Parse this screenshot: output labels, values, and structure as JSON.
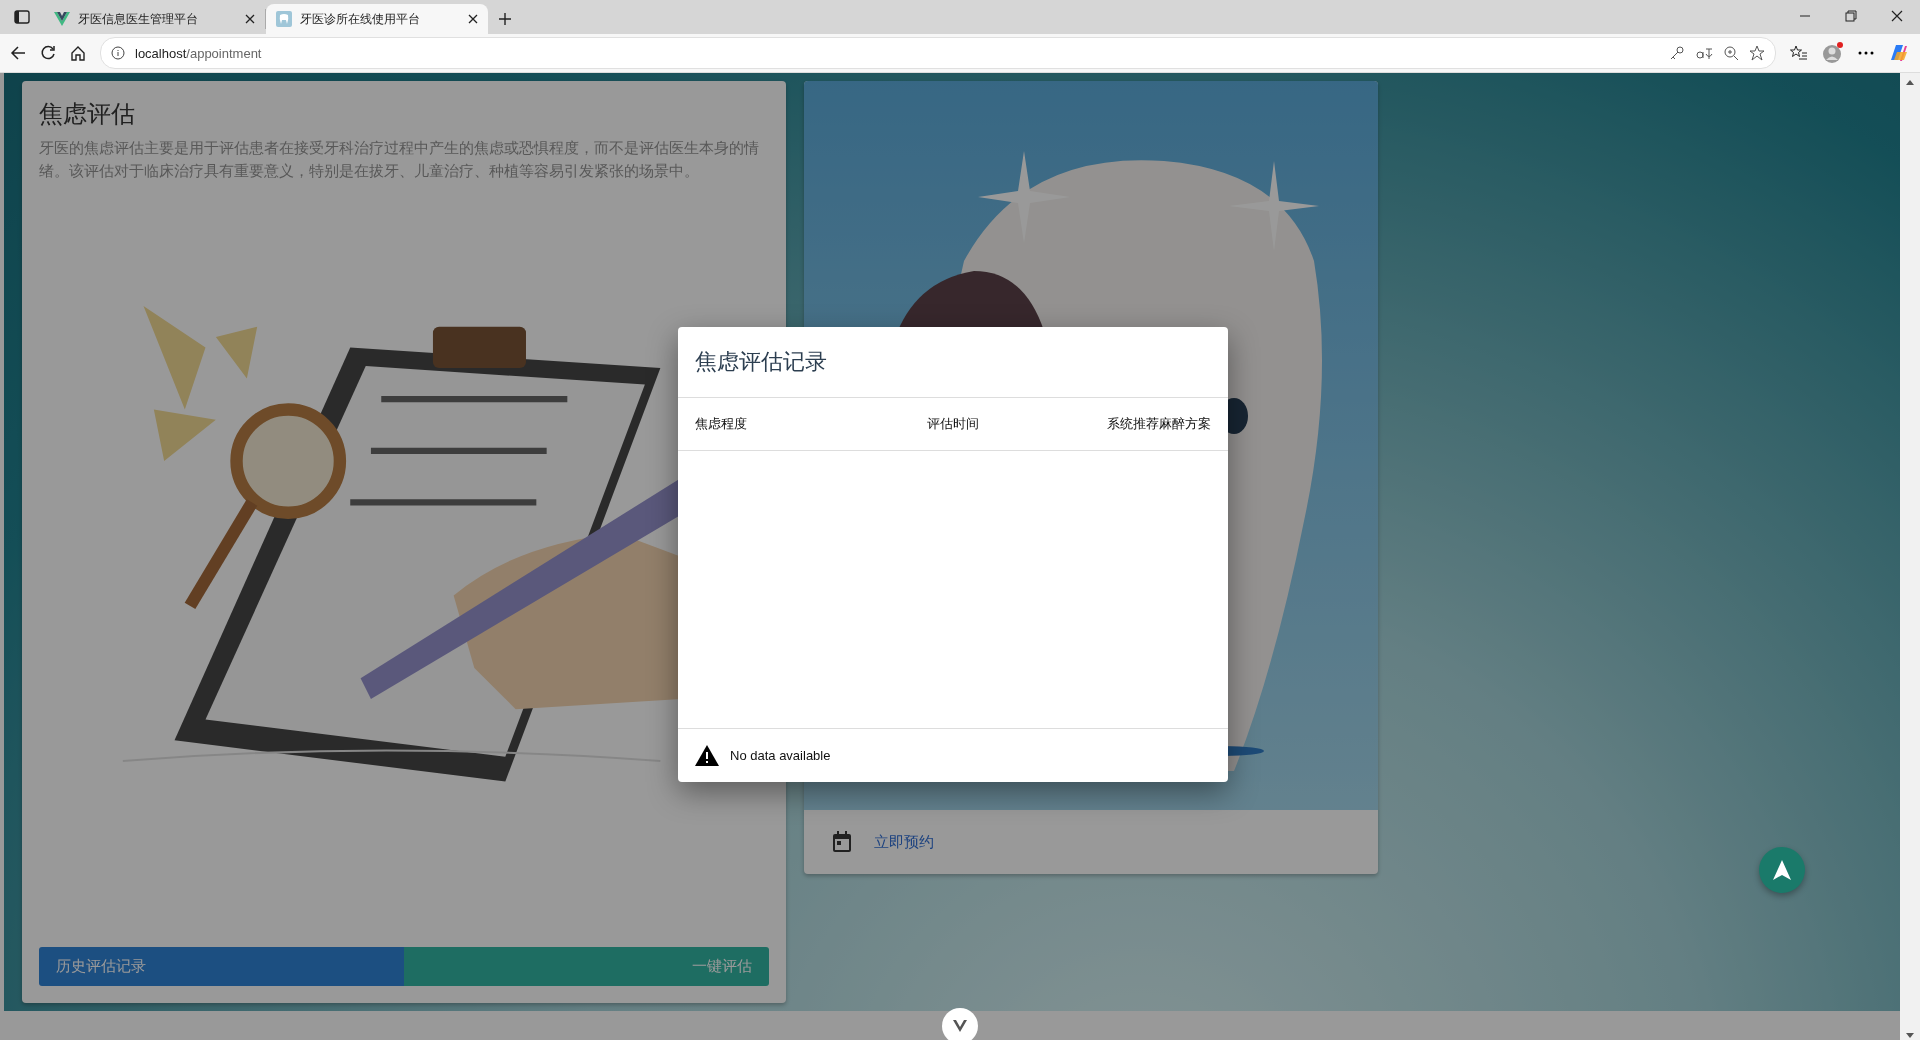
{
  "browser": {
    "tabs": [
      {
        "title": "牙医信息医生管理平台",
        "selected": false
      },
      {
        "title": "牙医诊所在线使用平台",
        "selected": true
      }
    ],
    "address": {
      "host": "localhost",
      "path": "/appointment"
    }
  },
  "assessment_card": {
    "title": "焦虑评估",
    "description": "牙医的焦虑评估主要是用于评估患者在接受牙科治疗过程中产生的焦虑或恐惧程度，而不是评估医生本身的情绪。该评估对于临床治疗具有重要意义，特别是在拔牙、儿童治疗、种植等容易引发紧张的场景中。",
    "buttons": [
      {
        "label": "历史评估记录",
        "kind": "history"
      },
      {
        "label": "一键评估",
        "kind": "assess"
      }
    ]
  },
  "booking_card": {
    "action": "立即预约"
  },
  "dialog": {
    "title": "焦虑评估记录",
    "columns": [
      "焦虑程度",
      "评估时间",
      "系统推荐麻醉方案"
    ],
    "empty_message": "No data available"
  }
}
